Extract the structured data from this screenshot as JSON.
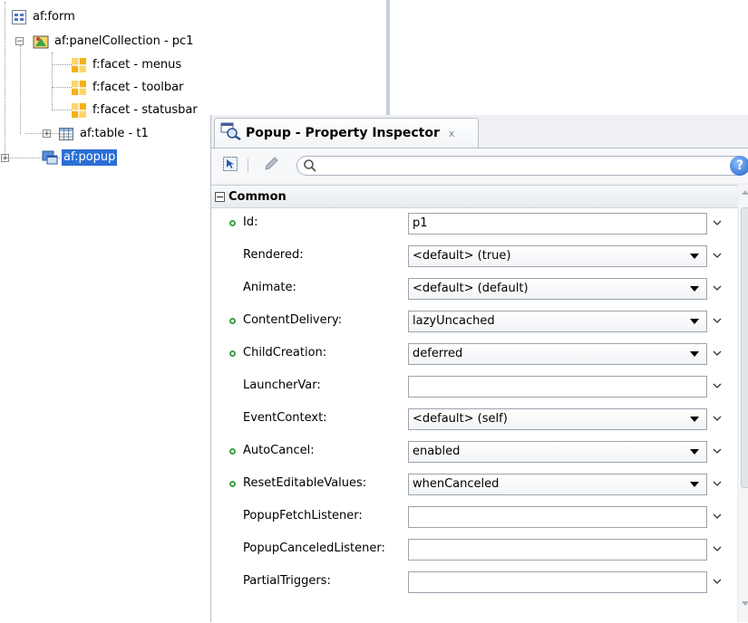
{
  "structure_tree": {
    "items": [
      {
        "label": "af:form",
        "icon": "form-icon",
        "selected": false
      },
      {
        "label": "af:panelCollection - pc1",
        "icon": "panel-collection-icon",
        "selected": false
      },
      {
        "label": "f:facet - menus",
        "icon": "facet-icon",
        "selected": false
      },
      {
        "label": "f:facet - toolbar",
        "icon": "facet-icon",
        "selected": false
      },
      {
        "label": "f:facet - statusbar",
        "icon": "facet-icon",
        "selected": false
      },
      {
        "label": "af:table - t1",
        "icon": "table-icon",
        "selected": false
      },
      {
        "label": "af:popup",
        "icon": "popup-icon",
        "selected": true
      }
    ]
  },
  "property_inspector": {
    "tab_title": "Popup - Property Inspector",
    "tab_close": "x",
    "search": {
      "value": "",
      "placeholder": ""
    },
    "help_label": "?",
    "section": {
      "collapse_symbol": "−",
      "title": "Common"
    },
    "properties": [
      {
        "label": "Id:",
        "value": "p1",
        "type": "text",
        "modified": true
      },
      {
        "label": "Rendered:",
        "value": "<default> (true)",
        "type": "combo",
        "modified": false
      },
      {
        "label": "Animate:",
        "value": "<default> (default)",
        "type": "combo",
        "modified": false
      },
      {
        "label": "ContentDelivery:",
        "value": "lazyUncached",
        "type": "combo",
        "modified": true
      },
      {
        "label": "ChildCreation:",
        "value": "deferred",
        "type": "combo",
        "modified": true
      },
      {
        "label": "LauncherVar:",
        "value": "",
        "type": "text",
        "modified": false
      },
      {
        "label": "EventContext:",
        "value": "<default> (self)",
        "type": "combo",
        "modified": false
      },
      {
        "label": "AutoCancel:",
        "value": "enabled",
        "type": "combo",
        "modified": true
      },
      {
        "label": "ResetEditableValues:",
        "value": "whenCanceled",
        "type": "combo",
        "modified": true
      },
      {
        "label": "PopupFetchListener:",
        "value": "",
        "type": "text",
        "modified": false
      },
      {
        "label": "PopupCanceledListener:",
        "value": "",
        "type": "text",
        "modified": false
      },
      {
        "label": "PartialTriggers:",
        "value": "",
        "type": "text",
        "modified": false
      }
    ]
  },
  "colors": {
    "selection": "#2a6fd6",
    "modified_dot": "#3aa045",
    "accent": "#1e5fc8"
  }
}
